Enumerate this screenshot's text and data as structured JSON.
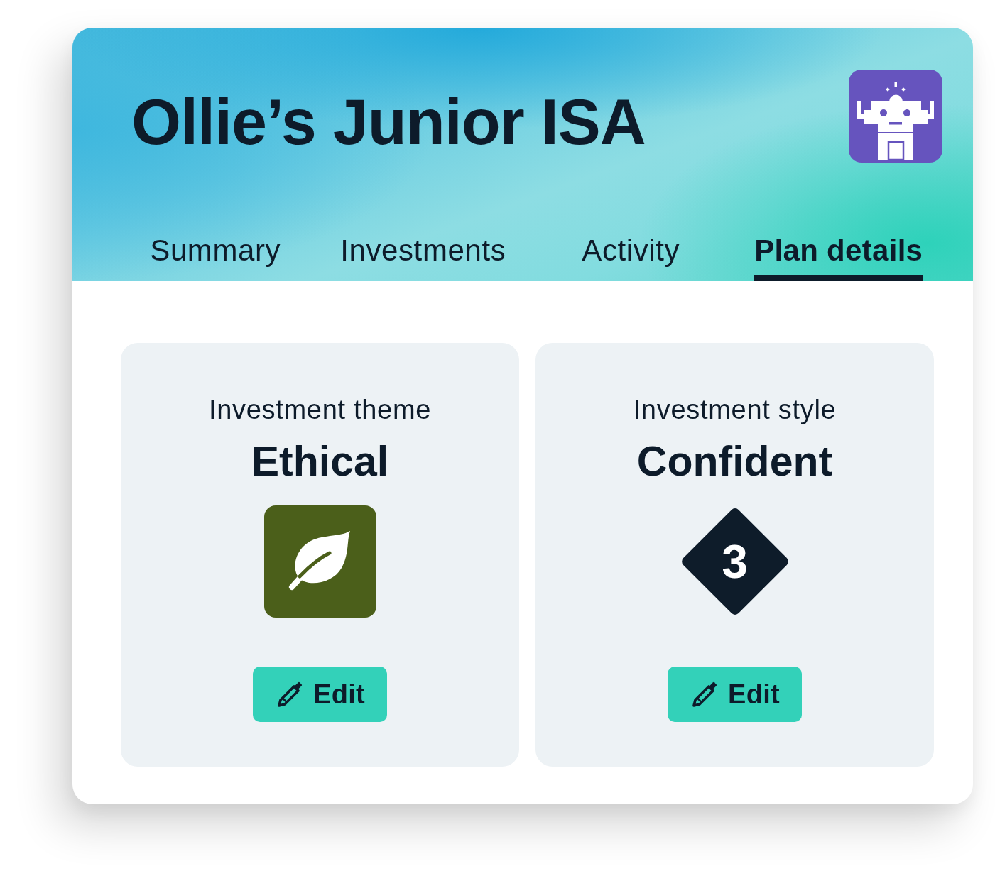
{
  "header": {
    "title": "Ollie’s Junior ISA"
  },
  "tabs": [
    {
      "label": "Summary",
      "selected": false
    },
    {
      "label": "Investments",
      "selected": false
    },
    {
      "label": "Activity",
      "selected": false
    },
    {
      "label": "Plan details",
      "selected": true
    }
  ],
  "cards": [
    {
      "kind": "theme",
      "label": "Investment theme",
      "value": "Ethical",
      "button": "Edit"
    },
    {
      "kind": "style",
      "label": "Investment style",
      "value": "Confident",
      "badge": "3",
      "button": "Edit"
    }
  ]
}
